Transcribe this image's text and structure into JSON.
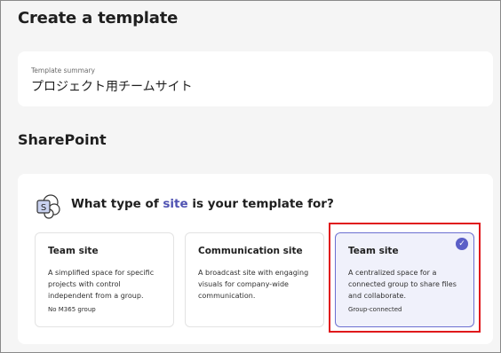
{
  "page": {
    "title": "Create a template"
  },
  "summary": {
    "label": "Template summary",
    "value": "プロジェクト用チームサイト"
  },
  "section": {
    "title": "SharePoint"
  },
  "question": {
    "prefix": "What type of ",
    "accent": "site",
    "suffix": " is your template for?"
  },
  "options": [
    {
      "title": "Team site",
      "description": "A simplified space for specific projects with control independent from a group.",
      "tag": "No M365 group",
      "selected": false
    },
    {
      "title": "Communication site",
      "description": "A broadcast site with engaging visuals for company-wide communication.",
      "tag": "",
      "selected": false
    },
    {
      "title": "Team site",
      "description": "A centralized space for a connected group to share files and collaborate.",
      "tag": "Group-connected",
      "selected": true
    }
  ],
  "icons": {
    "logo": "sharepoint-logo-icon",
    "selected_check": "checkmark-icon"
  },
  "colors": {
    "accent": "#4f52b2",
    "selected_border": "#6b6fd1",
    "selected_bg": "#f0f1fb",
    "highlight": "#e0191c"
  }
}
